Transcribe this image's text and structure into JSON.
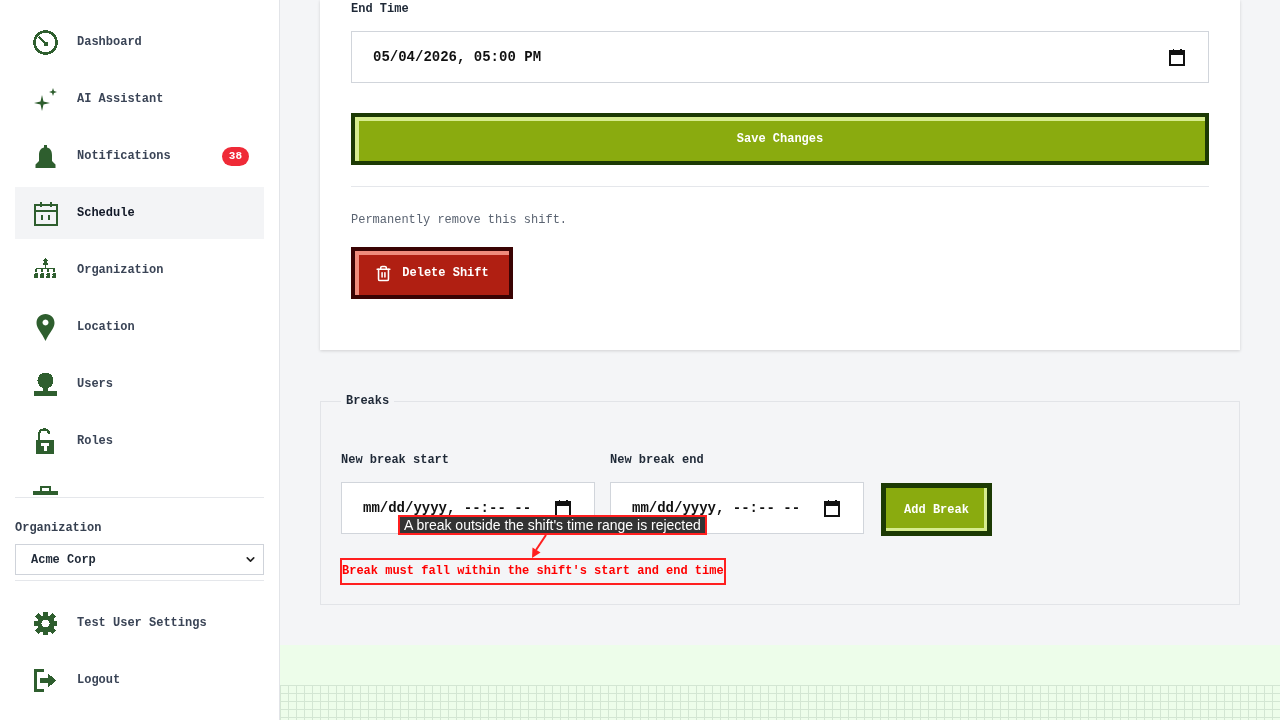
{
  "sidebar": {
    "nav_items": [
      {
        "label": "Dashboard",
        "selected": false
      },
      {
        "label": "AI Assistant",
        "selected": false
      },
      {
        "label": "Notifications",
        "selected": false,
        "badge": "38"
      },
      {
        "label": "Schedule",
        "selected": true
      },
      {
        "label": "Organization",
        "selected": false
      },
      {
        "label": "Location",
        "selected": false
      },
      {
        "label": "Users",
        "selected": false
      },
      {
        "label": "Roles",
        "selected": false
      }
    ],
    "more_items_below": true,
    "organization_select": {
      "label": "Organization",
      "value": "Acme Corp"
    },
    "footer_items": [
      {
        "label": "Test User Settings"
      },
      {
        "label": "Logout"
      }
    ]
  },
  "shift_form": {
    "end_time": {
      "label": "End Time",
      "value": "05/04/2026, 05:00 PM"
    },
    "save_button": "Save Changes",
    "delete_note": "Permanently remove this shift.",
    "delete_button": "Delete Shift"
  },
  "breaks": {
    "legend": "Breaks",
    "start": {
      "label": "New break start",
      "placeholder": "mm/dd/yyyy, --:-- --"
    },
    "end": {
      "label": "New break end",
      "placeholder": "mm/dd/yyyy, --:-- --"
    },
    "add_button": "Add Break",
    "error": "Break must fall within the shift's start and end time"
  },
  "annotation": {
    "label": "A break outside the shift's time range is rejected"
  }
}
